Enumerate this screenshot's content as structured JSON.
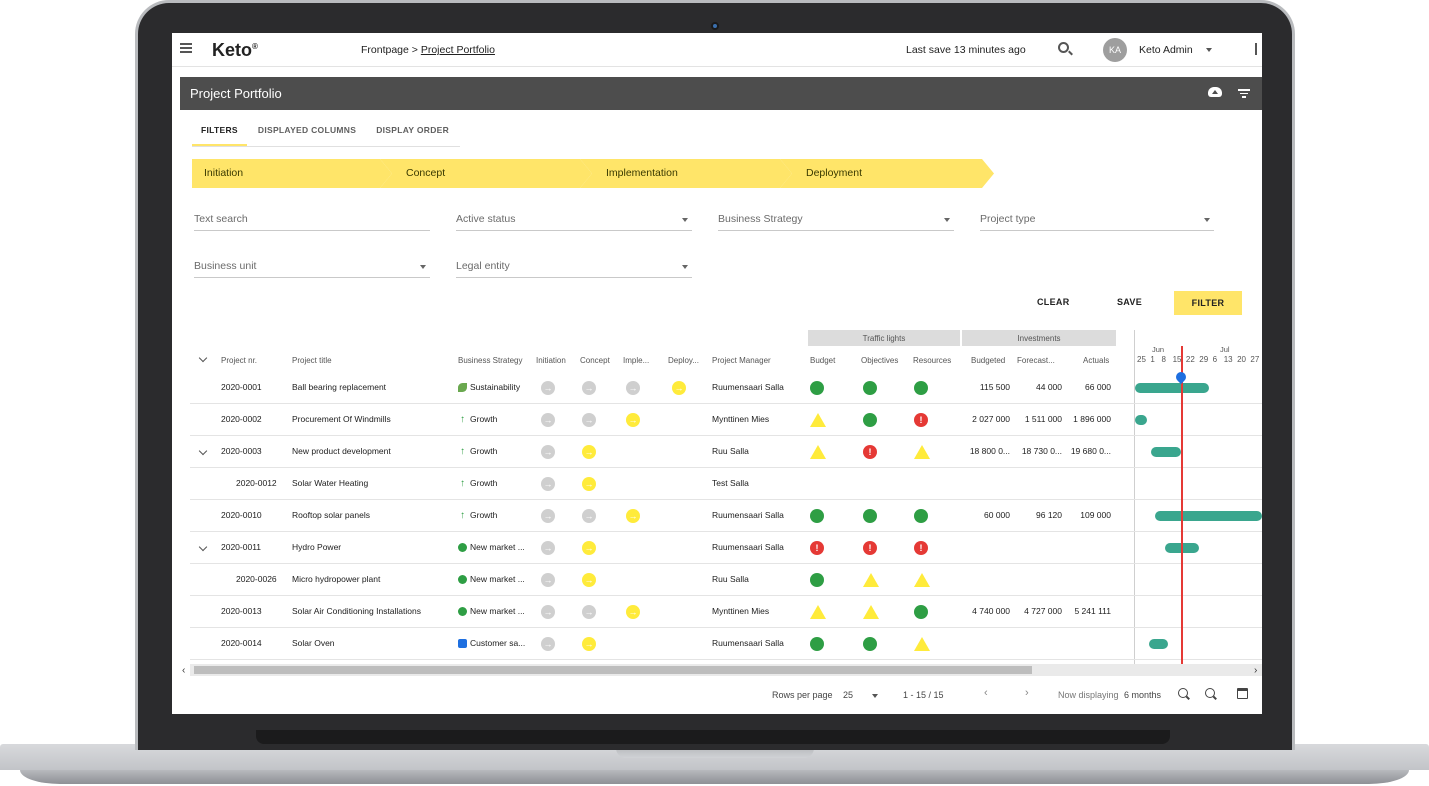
{
  "app": {
    "logo": "Keto",
    "logo_mark": "®"
  },
  "header": {
    "breadcrumb_root": "Frontpage >",
    "breadcrumb_current": "Project Portfolio",
    "last_save": "Last save 13 minutes ago",
    "avatar_initials": "KA",
    "user_name": "Keto Admin"
  },
  "page": {
    "title": "Project Portfolio"
  },
  "tabs": [
    {
      "label": "FILTERS",
      "active": true
    },
    {
      "label": "DISPLAYED COLUMNS",
      "active": false
    },
    {
      "label": "DISPLAY ORDER",
      "active": false
    }
  ],
  "phases": [
    "Initiation",
    "Concept",
    "Implementation",
    "Deployment"
  ],
  "filters": {
    "text_search": "Text search",
    "active_status": "Active status",
    "business_strategy": "Business Strategy",
    "project_type": "Project type",
    "business_unit": "Business unit",
    "legal_entity": "Legal entity"
  },
  "actions": {
    "clear": "CLEAR",
    "save": "SAVE",
    "filter": "FILTER"
  },
  "table": {
    "groups": {
      "traffic_lights": "Traffic lights",
      "investments": "Investments"
    },
    "columns": {
      "project_nr": "Project nr.",
      "project_title": "Project title",
      "business_strategy": "Business Strategy",
      "initiation": "Initiation",
      "concept": "Concept",
      "implementation": "Imple...",
      "deployment": "Deploy...",
      "project_manager": "Project Manager",
      "budget": "Budget",
      "objectives": "Objectives",
      "resources": "Resources",
      "budgeted": "Budgeted",
      "forecast": "Forecast...",
      "actuals": "Actuals"
    },
    "timeline": {
      "month1": "Jun",
      "month2": "Jul",
      "days": "25  1   8   15  22  29  6   13  20  27"
    },
    "rows": [
      {
        "nr": "2020-0001",
        "title": "Ball bearing replacement",
        "strategy": "Sustainability",
        "strategy_icon": "leaf-icon",
        "phases": [
          "grey",
          "grey",
          "grey",
          "yel"
        ],
        "manager": "Ruumensaari Salla",
        "lights": [
          "g",
          "g",
          "g"
        ],
        "budgeted": "115 500",
        "forecast": "44 000",
        "actuals": "66 000",
        "bar": {
          "start": 0,
          "end": 74
        },
        "child": false,
        "expandable": false
      },
      {
        "nr": "2020-0002",
        "title": "Procurement Of Windmills",
        "strategy": "Growth",
        "strategy_icon": "arrow-up-icon",
        "phases": [
          "grey",
          "grey",
          "yel",
          ""
        ],
        "manager": "Mynttinen Mies",
        "lights": [
          "t",
          "g",
          "r"
        ],
        "budgeted": "2 027 000",
        "forecast": "1 511 000",
        "actuals": "1 896 000",
        "bar": {
          "start": 0,
          "end": 12
        },
        "child": false,
        "expandable": false
      },
      {
        "nr": "2020-0003",
        "title": "New product development",
        "strategy": "Growth",
        "strategy_icon": "arrow-up-icon",
        "phases": [
          "grey",
          "yel",
          "",
          ""
        ],
        "manager": "Ruu Salla",
        "lights": [
          "t",
          "r",
          "t"
        ],
        "budgeted": "18 800 0...",
        "forecast": "18 730 0...",
        "actuals": "19 680 0...",
        "bar": {
          "start": 16,
          "end": 46
        },
        "child": false,
        "expandable": true
      },
      {
        "nr": "2020-0012",
        "title": "Solar Water Heating",
        "strategy": "Growth",
        "strategy_icon": "arrow-up-icon",
        "phases": [
          "grey",
          "yel",
          "",
          ""
        ],
        "manager": "Test Salla",
        "lights": [
          "",
          "",
          ""
        ],
        "budgeted": "",
        "forecast": "",
        "actuals": "",
        "bar": null,
        "child": true,
        "expandable": false
      },
      {
        "nr": "2020-0010",
        "title": "Rooftop solar panels",
        "strategy": "Growth",
        "strategy_icon": "arrow-up-icon",
        "phases": [
          "grey",
          "grey",
          "yel",
          ""
        ],
        "manager": "Ruumensaari Salla",
        "lights": [
          "g",
          "g",
          "g"
        ],
        "budgeted": "60 000",
        "forecast": "96 120",
        "actuals": "109 000",
        "bar": {
          "start": 20,
          "end": 150
        },
        "child": false,
        "expandable": false
      },
      {
        "nr": "2020-0011",
        "title": "Hydro Power",
        "strategy": "New market ...",
        "strategy_icon": "globe-icon",
        "phases": [
          "grey",
          "yel",
          "",
          ""
        ],
        "manager": "Ruumensaari Salla",
        "lights": [
          "r",
          "r",
          "r"
        ],
        "budgeted": "",
        "forecast": "",
        "actuals": "",
        "bar": {
          "start": 30,
          "end": 64
        },
        "child": false,
        "expandable": true
      },
      {
        "nr": "2020-0026",
        "title": "Micro hydropower plant",
        "strategy": "New market ...",
        "strategy_icon": "globe-icon",
        "phases": [
          "grey",
          "yel",
          "",
          ""
        ],
        "manager": "Ruu Salla",
        "lights": [
          "g",
          "t",
          "t"
        ],
        "budgeted": "",
        "forecast": "",
        "actuals": "",
        "bar": null,
        "child": true,
        "expandable": false
      },
      {
        "nr": "2020-0013",
        "title": "Solar Air Conditioning Installations",
        "strategy": "New market ...",
        "strategy_icon": "globe-icon",
        "phases": [
          "grey",
          "grey",
          "yel",
          ""
        ],
        "manager": "Mynttinen Mies",
        "lights": [
          "t",
          "t",
          "g"
        ],
        "budgeted": "4 740 000",
        "forecast": "4 727 000",
        "actuals": "5 241 111",
        "bar": {
          "start": 133,
          "end": 150
        },
        "child": false,
        "expandable": false
      },
      {
        "nr": "2020-0014",
        "title": "Solar Oven",
        "strategy": "Customer sa...",
        "strategy_icon": "thumbs-up-icon",
        "phases": [
          "grey",
          "yel",
          "",
          ""
        ],
        "manager": "Ruumensaari Salla",
        "lights": [
          "g",
          "g",
          "t"
        ],
        "budgeted": "",
        "forecast": "",
        "actuals": "",
        "bar": {
          "start": 14,
          "end": 33
        },
        "child": false,
        "expandable": false
      }
    ]
  },
  "pager": {
    "rows_per_page_label": "Rows per page",
    "rows_per_page": "25",
    "range": "1 - 15 / 15",
    "now_displaying_label": "Now displaying",
    "now_displaying": "6 months"
  },
  "colors": {
    "accent": "#ffe569",
    "green": "#2e9e44",
    "red": "#e53935",
    "bar": "#3aa68e"
  }
}
